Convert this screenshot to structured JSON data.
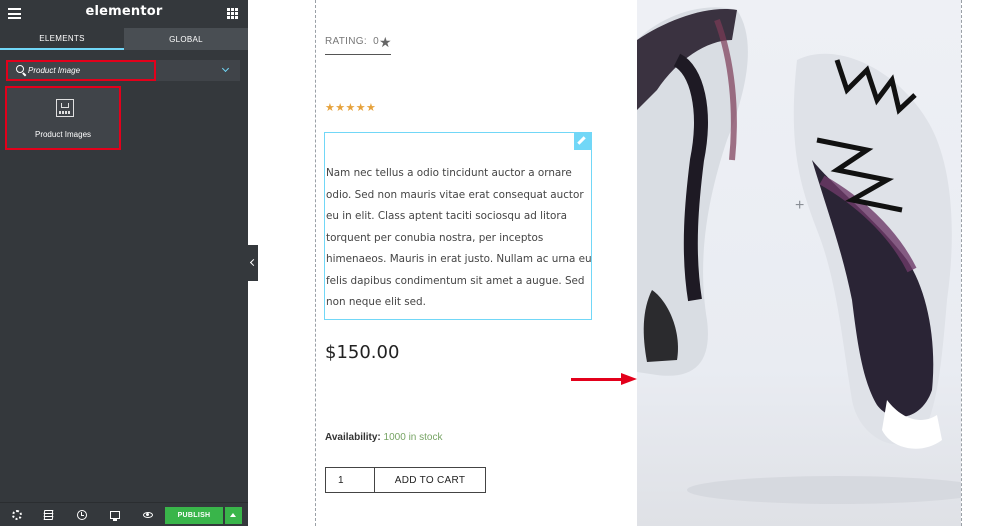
{
  "editor": {
    "brand": "elementor",
    "tabs": [
      {
        "label": "ELEMENTS",
        "active": true
      },
      {
        "label": "GLOBAL",
        "active": false
      }
    ],
    "search": {
      "value": "Product Image"
    },
    "widget": {
      "label": "Product Images",
      "icon": "product-images-icon"
    },
    "bottom_bar": {
      "icons": [
        "gear-icon",
        "layers-icon",
        "history-icon",
        "responsive-icon",
        "eye-icon"
      ],
      "publish_label": "PUBLISH"
    }
  },
  "preview": {
    "rating_label": "RATING:",
    "rating_value": "0",
    "stars": "★★★★★",
    "description": "Nam nec tellus a odio tincidunt auctor a ornare odio. Sed non mauris vitae erat consequat auctor eu in elit. Class aptent taciti sociosqu ad litora torquent per conubia nostra, per inceptos himenaeos. Mauris in erat justo. Nullam ac urna eu felis dapibus condimentum sit amet a augue. Sed non neque elit sed.",
    "price": "$150.00",
    "availability_label": "Availability:",
    "availability_value": "1000 in stock",
    "quantity": "1",
    "add_to_cart_label": "ADD TO CART"
  },
  "colors": {
    "panel": "#34383c",
    "accent": "#71d7f7",
    "publish": "#39b54a",
    "highlight": "#e3001b",
    "stars": "#e6a23c",
    "stock": "#77a464"
  }
}
